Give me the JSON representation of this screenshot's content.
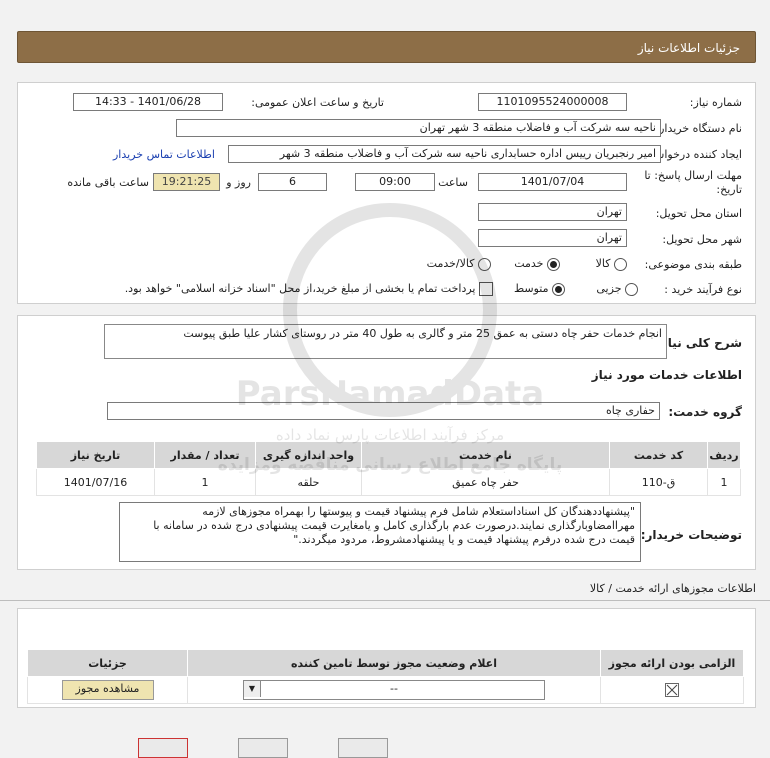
{
  "header": {
    "title": "جزئیات اطلاعات نیاز"
  },
  "form": {
    "need_number_label": "شماره نیاز:",
    "need_number": "1101095524000008",
    "announce_label": "تاریخ و ساعت اعلان عمومی:",
    "announce_value": "1401/06/28 - 14:33",
    "buyer_org_label": "نام دستگاه خریدار:",
    "buyer_org": "ناحیه سه شرکت آب و فاضلاب منطقه 3 شهر تهران",
    "requester_label": "ایجاد کننده درخواست:",
    "requester": "امیر رنجبریان رییس اداره حسابداری ناحیه سه شرکت آب و فاضلاب منطقه 3 شهر",
    "contact_link": "اطلاعات تماس خریدار",
    "deadline_label_1": "مهلت ارسال پاسخ: تا",
    "deadline_label_2": "تاریخ:",
    "deadline_date": "1401/07/04",
    "time_label": "ساعت",
    "deadline_time": "09:00",
    "days_value": "6",
    "days_label": "روز و",
    "remaining_time": "19:21:25",
    "remaining_label": "ساعت باقی مانده",
    "province_label": "استان محل تحویل:",
    "province": "تهران",
    "city_label": "شهر محل تحویل:",
    "city": "تهران",
    "category_label": "طبقه بندی موضوعی:",
    "category_options": [
      "کالا",
      "خدمت",
      "کالا/خدمت"
    ],
    "category_selected": "خدمت",
    "process_label": "نوع فرآیند خرید :",
    "process_options": [
      "جزیی",
      "متوسط"
    ],
    "process_selected": "متوسط",
    "payment_note": "پرداخت تمام یا بخشی از مبلغ خرید،از محل \"اسناد خزانه اسلامی\" خواهد بود."
  },
  "description": {
    "label": "شرح کلی نیاز:",
    "text": "انجام خدمات حفر چاه دستی به عمق 25 متر و گالری به طول 40 متر در روستای کشار علیا  طبق پیوست"
  },
  "services": {
    "section_title": "اطلاعات خدمات مورد نیاز",
    "group_label": "گروه خدمت:",
    "group_value": "حفاری چاه",
    "columns": [
      "ردیف",
      "کد خدمت",
      "نام خدمت",
      "واحد اندازه گیری",
      "تعداد / مقدار",
      "تاریخ نیاز"
    ],
    "rows": [
      [
        "1",
        "ق-110",
        "حفر چاه عمیق",
        "حلقه",
        "1",
        "1401/07/16"
      ]
    ]
  },
  "buyer_notes": {
    "label": "توضیحات خریدار:",
    "text": "\"پیشنهاددهندگان کل اسناداستعلام شامل فرم پیشنهاد قیمت و پیوستها را بهمراه مجوزهای لازمه مهراامضاوبارگذاری نمایند.درصورت عدم بارگذاری کامل و یامغایرت قیمت پیشنهادی درج شده در سامانه با قیمت درج شده درفرم پیشنهاد قیمت و یا پیشنهادمشروط، مردود میگردند.\""
  },
  "permits": {
    "section_title": "اطلاعات مجوزهای ارائه خدمت / کالا",
    "columns": [
      "الزامی بودن ارائه مجوز",
      "اعلام وضعیت مجوز توسط تامین کننده",
      "جزئیات"
    ],
    "select_value": "--",
    "view_button": "مشاهده مجوز"
  },
  "watermark": {
    "line1": "ParsNamadData",
    "line2": "مرکز فرآیند اطلاعات پارس نماد داده",
    "line3": "پایگاه جامع اطلاع رسانی مناقصه ومزایده"
  }
}
